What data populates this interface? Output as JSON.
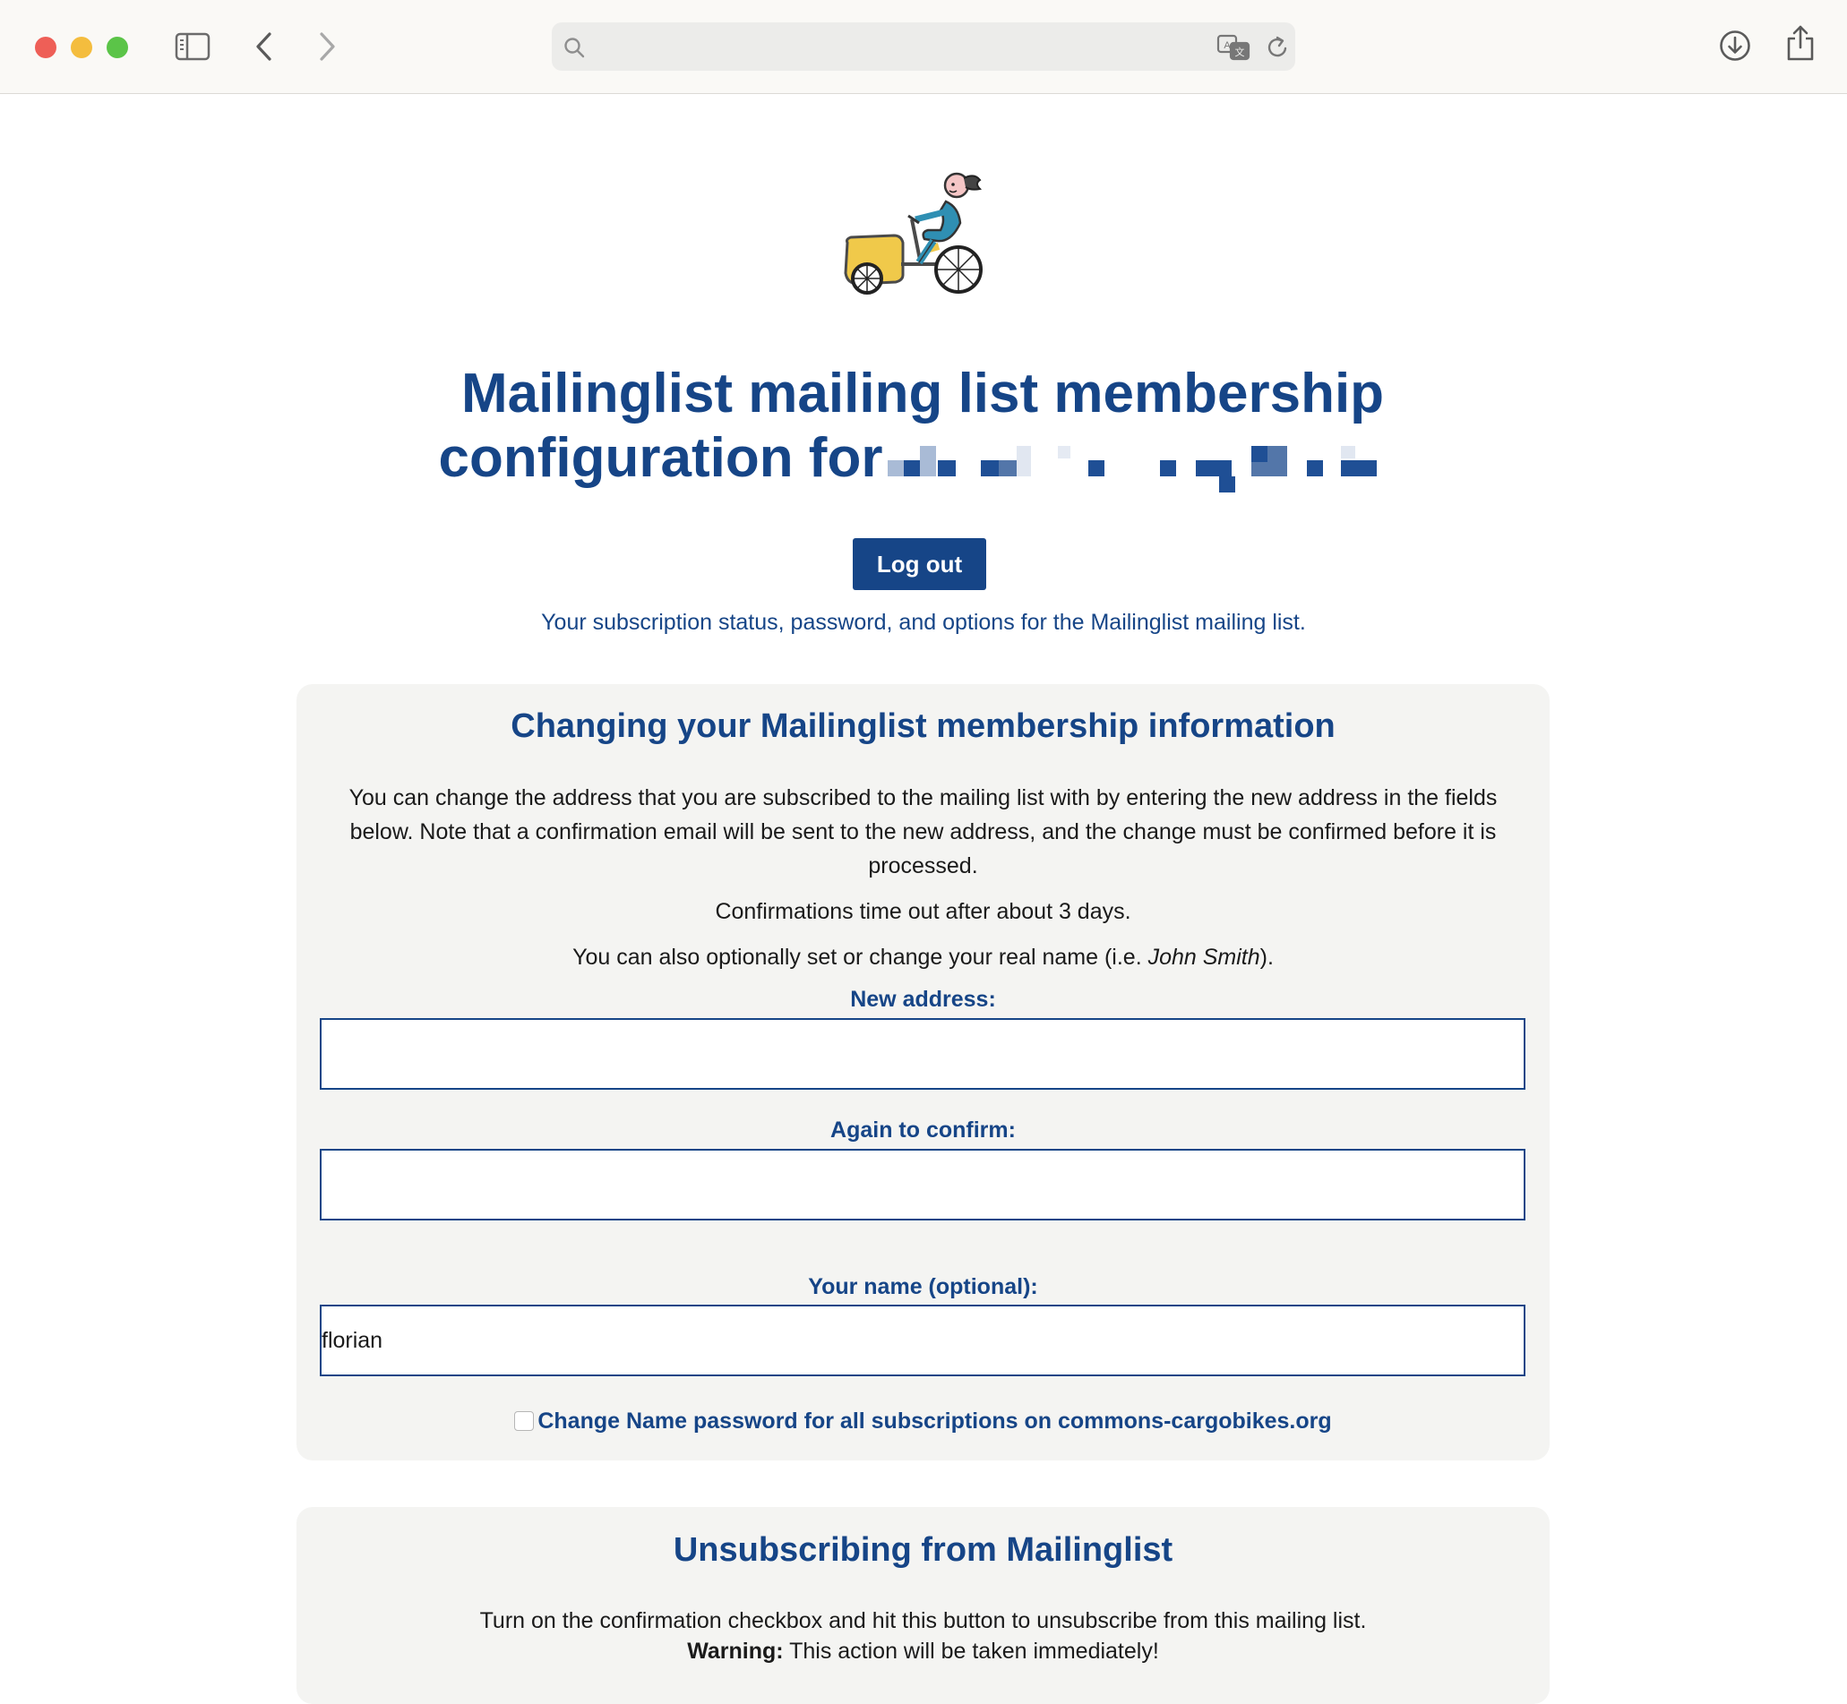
{
  "browser": {
    "address_text": "",
    "icons": [
      "sidebar-icon",
      "back-icon",
      "forward-icon",
      "search-icon",
      "translate-icon",
      "reload-icon",
      "download-icon",
      "share-icon"
    ]
  },
  "page": {
    "title_line1": "Mailinglist mailing list membership",
    "title_line2_prefix": "configuration for",
    "logout_label": "Log out",
    "intro": "Your subscription status, password, and options for the Mailinglist mailing list."
  },
  "membership": {
    "heading": "Changing your Mailinglist membership information",
    "paragraph1": "You can change the address that you are subscribed to the mailing list with by entering the new address in the fields below. Note that a confirmation email will be sent to the new address, and the change must be confirmed before it is processed.",
    "paragraph2": "Confirmations time out after about 3 days.",
    "paragraph3_before": "You can also optionally set or change your real name (i.e. ",
    "paragraph3_example": "John Smith",
    "paragraph3_after": ").",
    "new_address_label": "New address:",
    "new_address_value": "",
    "confirm_label": "Again to confirm:",
    "confirm_value": "",
    "name_label": "Your name (optional):",
    "name_value": "florian",
    "global_change_label": "Change Name password for all subscriptions on commons-cargobikes.org",
    "global_change_checked": false
  },
  "unsubscribe": {
    "heading": "Unsubscribing from Mailinglist",
    "text": "Turn on the confirmation checkbox and hit this button to unsubscribe from this mailing list.",
    "warning_label": "Warning:",
    "warning_text": " This action will be taken immediately!"
  },
  "colors": {
    "brand": "#164587",
    "panel_bg": "#f4f4f2",
    "logo_bike": "#f0c94a",
    "logo_rider": "#2f8fb3"
  }
}
